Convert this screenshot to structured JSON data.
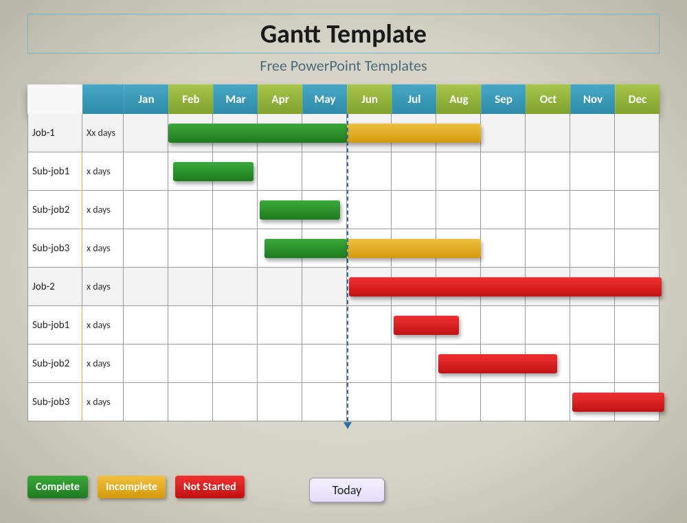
{
  "title": "Gantt Template",
  "subtitle": "Free PowerPoint Templates",
  "months": [
    "Jan",
    "Feb",
    "Mar",
    "Apr",
    "May",
    "Jun",
    "Jul",
    "Aug",
    "Sep",
    "Oct",
    "Nov",
    "Dec"
  ],
  "rows": [
    {
      "label": "Job-1",
      "duration": "Xx days",
      "job": true,
      "bars": [
        {
          "start": 1,
          "end": 5,
          "status": "green"
        },
        {
          "start": 5,
          "end": 8,
          "status": "yellow"
        }
      ]
    },
    {
      "label": "Sub-job1",
      "duration": "x days",
      "job": false,
      "bars": [
        {
          "start": 1.1,
          "end": 2.9,
          "status": "green"
        }
      ]
    },
    {
      "label": "Sub-job2",
      "duration": "x days",
      "job": false,
      "bars": [
        {
          "start": 3.05,
          "end": 4.85,
          "status": "green"
        }
      ]
    },
    {
      "label": "Sub-job3",
      "duration": "x days",
      "job": false,
      "bars": [
        {
          "start": 3.15,
          "end": 5,
          "status": "green"
        },
        {
          "start": 5,
          "end": 8,
          "status": "yellow"
        }
      ]
    },
    {
      "label": "Job-2",
      "duration": "x days",
      "job": true,
      "bars": [
        {
          "start": 5.05,
          "end": 12.05,
          "status": "red"
        }
      ]
    },
    {
      "label": "Sub-job1",
      "duration": "x days",
      "job": false,
      "bars": [
        {
          "start": 6.05,
          "end": 7.5,
          "status": "red"
        }
      ]
    },
    {
      "label": "Sub-job2",
      "duration": "x days",
      "job": false,
      "bars": [
        {
          "start": 7.05,
          "end": 9.7,
          "status": "red"
        }
      ]
    },
    {
      "label": "Sub-job3",
      "duration": "x days",
      "job": false,
      "bars": [
        {
          "start": 10.05,
          "end": 12.1,
          "status": "red"
        }
      ]
    }
  ],
  "today_month_index": 5,
  "today_label": "Today",
  "legend": [
    {
      "text": "Complete",
      "class": "green"
    },
    {
      "text": "Incomplete",
      "class": "yellow"
    },
    {
      "text": "Not Started",
      "class": "red"
    }
  ],
  "colors": {
    "green": "#2a8a2a",
    "yellow": "#e0a814",
    "red": "#d41c1c",
    "header_blue": "#3a98b6",
    "header_green": "#94b63a"
  },
  "chart_data": {
    "type": "gantt",
    "title": "Gantt Template",
    "xlabel": "",
    "ylabel": "",
    "x_categories": [
      "Jan",
      "Feb",
      "Mar",
      "Apr",
      "May",
      "Jun",
      "Jul",
      "Aug",
      "Sep",
      "Oct",
      "Nov",
      "Dec"
    ],
    "today": "Jun",
    "tasks": [
      {
        "name": "Job-1",
        "duration_label": "Xx days",
        "segments": [
          {
            "start": "Feb",
            "end": "Jun",
            "status": "Complete"
          },
          {
            "start": "Jun",
            "end": "Sep",
            "status": "Incomplete"
          }
        ]
      },
      {
        "name": "Sub-job1",
        "duration_label": "x days",
        "segments": [
          {
            "start": "Feb",
            "end": "Mar",
            "status": "Complete"
          }
        ]
      },
      {
        "name": "Sub-job2",
        "duration_label": "x days",
        "segments": [
          {
            "start": "Apr",
            "end": "May",
            "status": "Complete"
          }
        ]
      },
      {
        "name": "Sub-job3",
        "duration_label": "x days",
        "segments": [
          {
            "start": "Apr",
            "end": "Jun",
            "status": "Complete"
          },
          {
            "start": "Jun",
            "end": "Sep",
            "status": "Incomplete"
          }
        ]
      },
      {
        "name": "Job-2",
        "duration_label": "x days",
        "segments": [
          {
            "start": "Jun",
            "end": "Dec",
            "status": "Not Started"
          }
        ]
      },
      {
        "name": "Sub-job1",
        "duration_label": "x days",
        "segments": [
          {
            "start": "Jul",
            "end": "Aug",
            "status": "Not Started"
          }
        ]
      },
      {
        "name": "Sub-job2",
        "duration_label": "x days",
        "segments": [
          {
            "start": "Aug",
            "end": "Oct",
            "status": "Not Started"
          }
        ]
      },
      {
        "name": "Sub-job3",
        "duration_label": "x days",
        "segments": [
          {
            "start": "Nov",
            "end": "Dec",
            "status": "Not Started"
          }
        ]
      }
    ],
    "legend": [
      "Complete",
      "Incomplete",
      "Not Started"
    ]
  }
}
